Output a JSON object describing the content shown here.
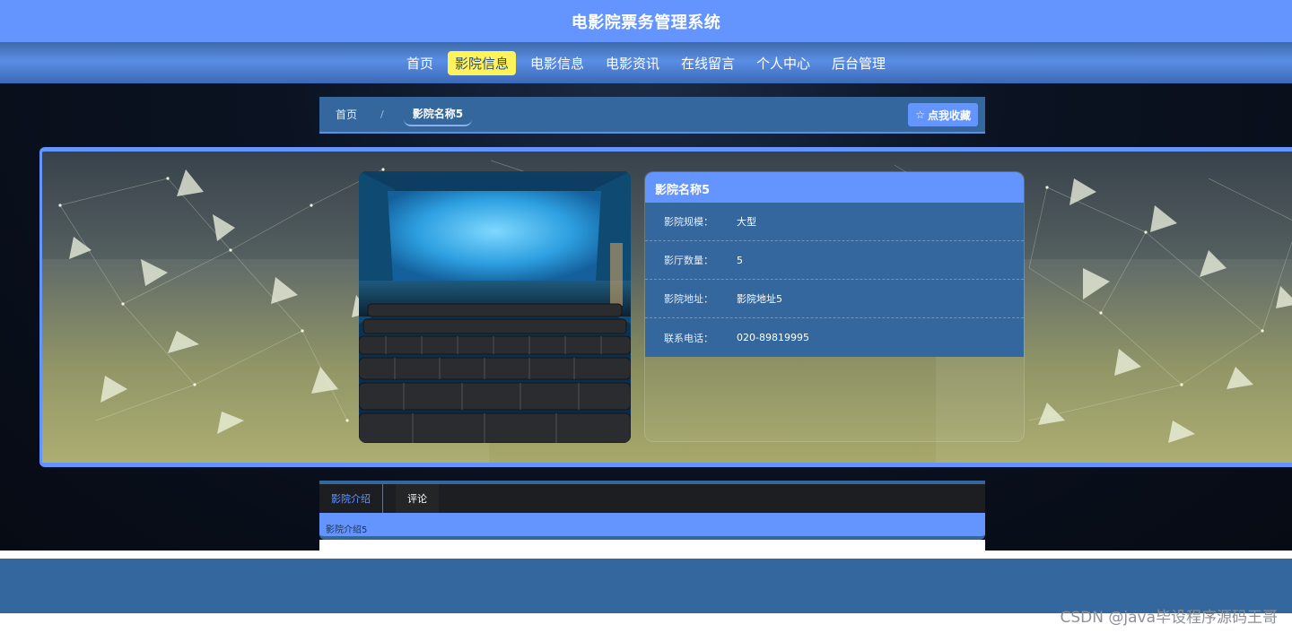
{
  "site": {
    "title": "电影院票务管理系统"
  },
  "nav": {
    "items": [
      {
        "label": "首页",
        "active": false
      },
      {
        "label": "影院信息",
        "active": true
      },
      {
        "label": "电影信息",
        "active": false
      },
      {
        "label": "电影资讯",
        "active": false
      },
      {
        "label": "在线留言",
        "active": false
      },
      {
        "label": "个人中心",
        "active": false
      },
      {
        "label": "后台管理",
        "active": false
      }
    ]
  },
  "breadcrumb": {
    "home": "首页",
    "separator": "/",
    "current": "影院名称5"
  },
  "favorite": {
    "icon": "star-icon",
    "label": "点我收藏"
  },
  "cinema": {
    "name": "影院名称5",
    "fields": [
      {
        "label": "影院规模：",
        "value": "大型"
      },
      {
        "label": "影厅数量：",
        "value": "5"
      },
      {
        "label": "影院地址：",
        "value": "影院地址5"
      },
      {
        "label": "联系电话：",
        "value": "020-89819995"
      }
    ]
  },
  "tabs": {
    "items": [
      {
        "label": "影院介绍",
        "active": true
      },
      {
        "label": "评论",
        "active": false
      }
    ],
    "content": "影院介绍5"
  },
  "watermark": "CSDN @java毕设程序源码王哥",
  "colors": {
    "primary": "#6495ff",
    "secondary": "#34679d",
    "highlight": "#fff35a"
  }
}
